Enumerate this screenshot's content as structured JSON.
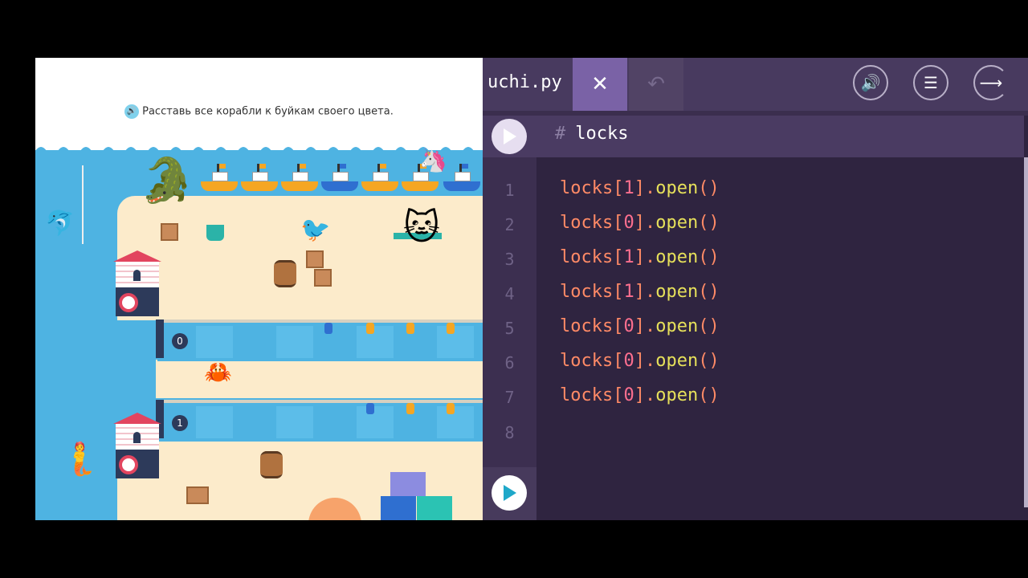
{
  "game": {
    "task_text": "Расставь все корабли к буйкам своего цвета.",
    "lock_labels": [
      "0",
      "1"
    ]
  },
  "editor": {
    "file_name": "uchi.py",
    "close_icon": "close-icon",
    "undo_icon": "undo-icon",
    "sound_icon": "speaker-icon",
    "menu_icon": "list-icon",
    "next_icon": "arrow-right-icon",
    "header_comment_hash": "#",
    "header_comment_text": "locks",
    "line_numbers": [
      "1",
      "2",
      "3",
      "4",
      "5",
      "6",
      "7",
      "8"
    ],
    "code_lines": [
      {
        "obj": "locks[",
        "idx": "1",
        "rest_a": "].",
        "method": "open",
        "rest_b": "()"
      },
      {
        "obj": "locks[",
        "idx": "0",
        "rest_a": "].",
        "method": "open",
        "rest_b": "()"
      },
      {
        "obj": "locks[",
        "idx": "1",
        "rest_a": "].",
        "method": "open",
        "rest_b": "()"
      },
      {
        "obj": "locks[",
        "idx": "1",
        "rest_a": "].",
        "method": "open",
        "rest_b": "()"
      },
      {
        "obj": "locks[",
        "idx": "0",
        "rest_a": "].",
        "method": "open",
        "rest_b": "()"
      },
      {
        "obj": "locks[",
        "idx": "0",
        "rest_a": "].",
        "method": "open",
        "rest_b": "()"
      },
      {
        "obj": "locks[",
        "idx": "0",
        "rest_a": "].",
        "method": "open",
        "rest_b": "()"
      }
    ],
    "colors": {
      "accent": "#7a62a6",
      "code_text": "#ff8a66",
      "method": "#e6e05a"
    }
  }
}
